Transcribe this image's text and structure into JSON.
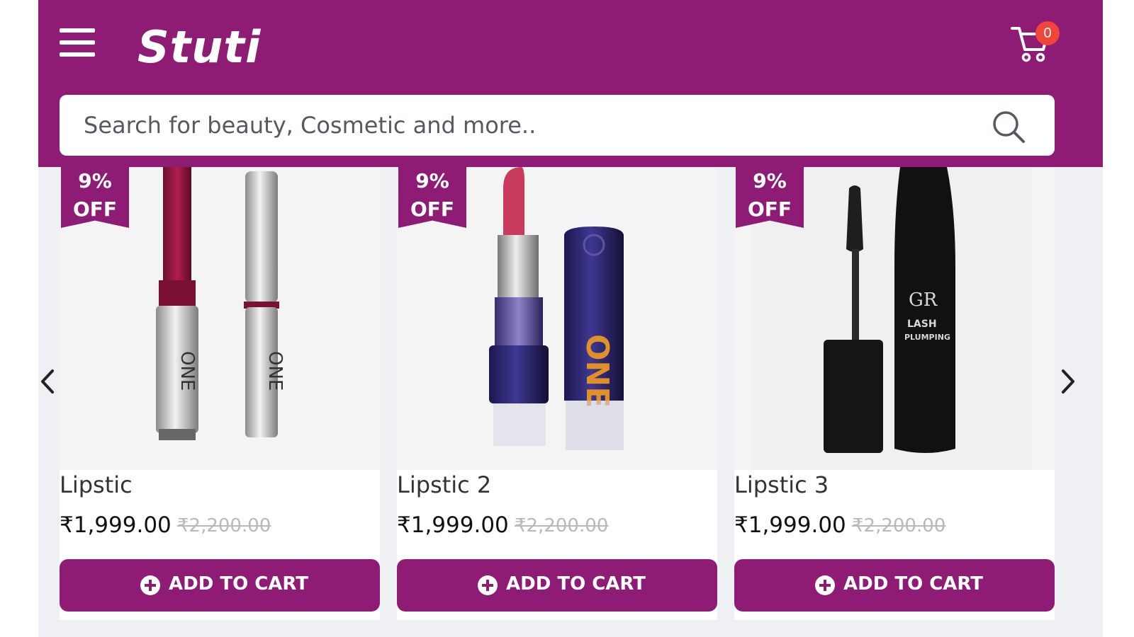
{
  "header": {
    "logo_text": "Stuti",
    "cart_count": "0",
    "search_placeholder": "Search for beauty, Cosmetic and more..",
    "brand_color": "#8e1c74",
    "badge_color": "#f0453a"
  },
  "icons": {
    "menu": "hamburger-menu-icon",
    "cart": "shopping-cart-icon",
    "search": "search-icon",
    "prev": "chevron-left-icon",
    "next": "chevron-right-icon",
    "add": "plus-circle-icon"
  },
  "products": [
    {
      "discount_pct": "9%",
      "discount_word": "OFF",
      "name": "Lipstic",
      "price": "₹1,999.00",
      "old_price": "₹2,200.00",
      "button": "ADD TO CART"
    },
    {
      "discount_pct": "9%",
      "discount_word": "OFF",
      "name": "Lipstic 2",
      "price": "₹1,999.00",
      "old_price": "₹2,200.00",
      "button": "ADD TO CART"
    },
    {
      "discount_pct": "9%",
      "discount_word": "OFF",
      "name": "Lipstic 3",
      "price": "₹1,999.00",
      "old_price": "₹2,200.00",
      "button": "ADD TO CART"
    }
  ]
}
